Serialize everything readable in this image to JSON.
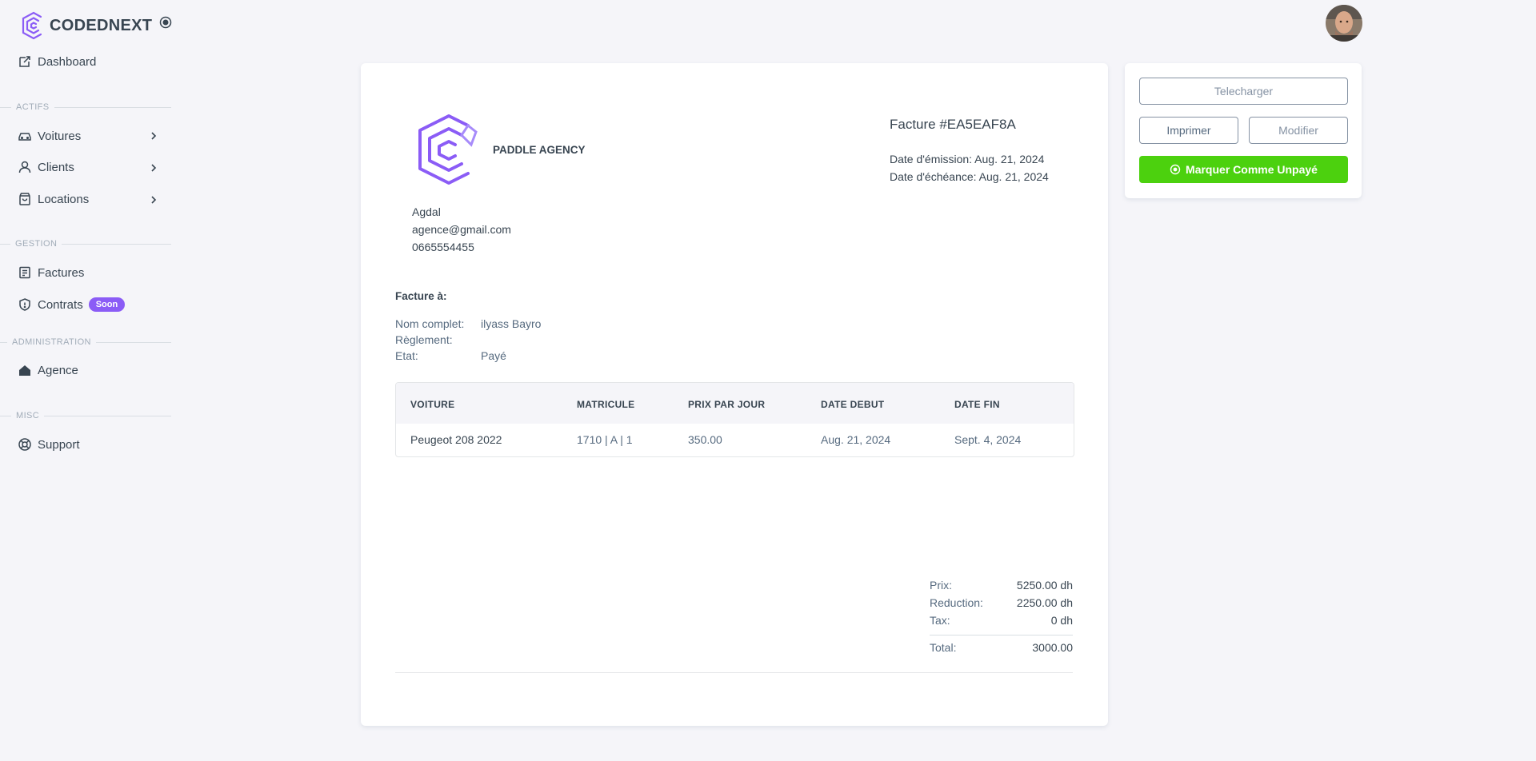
{
  "brand": {
    "name": "CODEDNEXT"
  },
  "sidebar": {
    "dashboard": "Dashboard",
    "sections": {
      "actifs": "ACTIFS",
      "gestion": "GESTION",
      "administration": "ADMINISTRATION",
      "misc": "MISC"
    },
    "items": {
      "voitures": "Voitures",
      "clients": "Clients",
      "locations": "Locations",
      "factures": "Factures",
      "contrats": "Contrats",
      "contrats_badge": "Soon",
      "agence": "Agence",
      "support": "Support"
    }
  },
  "invoice": {
    "agency_name": "PADDLE AGENCY",
    "agency_address": "Agdal",
    "agency_email": "agence@gmail.com",
    "agency_phone": "0665554455",
    "number": "Facture #EA5EAF8A",
    "issue_date": "Date d'émission: Aug. 21, 2024",
    "due_date": "Date d'échéance: Aug. 21, 2024",
    "bill_to_title": "Facture à:",
    "bill_to": {
      "name_label": "Nom complet:",
      "name_value": "ilyass Bayro",
      "payment_label": "Règlement:",
      "payment_value": "",
      "status_label": "Etat:",
      "status_value": "Payé"
    },
    "table": {
      "headers": [
        "VOITURE",
        "MATRICULE",
        "PRIX PAR JOUR",
        "DATE DEBUT",
        "DATE FIN"
      ],
      "rows": [
        [
          "Peugeot 208 2022",
          "1710 | A | 1",
          "350.00",
          "Aug. 21, 2024",
          "Sept. 4, 2024"
        ]
      ]
    },
    "totals": {
      "price_label": "Prix:",
      "price_value": "5250.00 dh",
      "reduction_label": "Reduction:",
      "reduction_value": "2250.00 dh",
      "tax_label": "Tax:",
      "tax_value": "0 dh",
      "total_label": "Total:",
      "total_value": "3000.00"
    }
  },
  "actions": {
    "download": "Telecharger",
    "print": "Imprimer",
    "edit": "Modifier",
    "mark_unpaid": "Marquer Comme Unpayé"
  },
  "colors": {
    "brand_purple": "#8b5cf6",
    "success_green": "#4cd10e",
    "text_dark": "#384551",
    "text_muted": "#566a7f"
  },
  "icons": {
    "brand": "codednext-logo",
    "collapse": "radio-circle-icon",
    "dashboard": "dashboard-icon",
    "voitures": "car-icon",
    "clients": "user-icon",
    "locations": "shopping-bag-icon",
    "factures": "receipt-icon",
    "contrats": "shield-icon",
    "agence": "home-icon",
    "support": "lifebuoy-icon",
    "mark_unpaid": "check-circle-icon"
  }
}
